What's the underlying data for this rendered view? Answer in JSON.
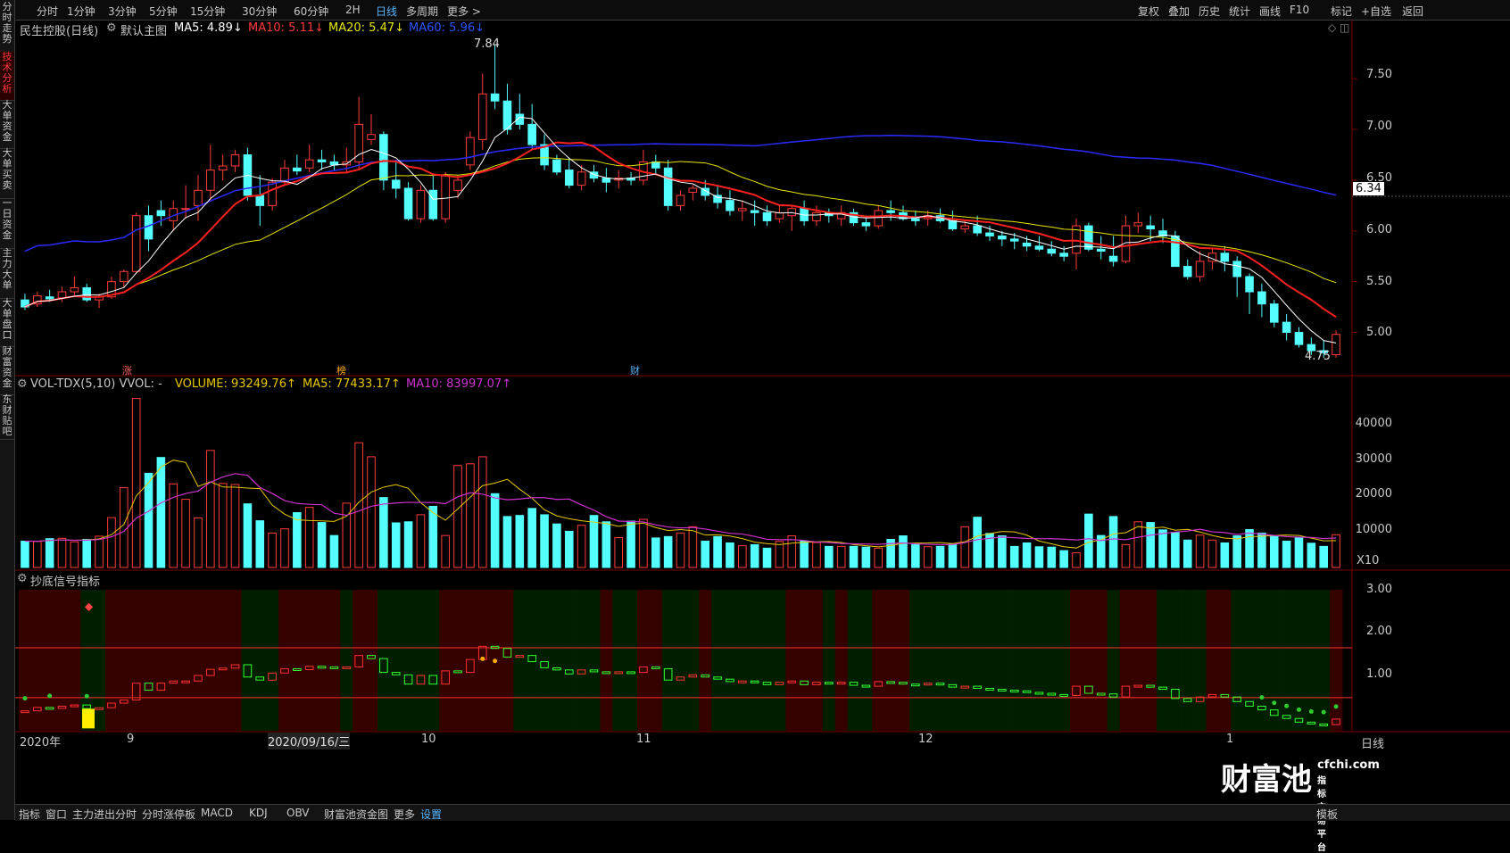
{
  "left_tabs": [
    "分时走势",
    "技术分析",
    "大单资金",
    "大单买卖",
    "一日资金",
    "主力大单",
    "大单盘口",
    "财富资金",
    "东财贴吧"
  ],
  "top_tabs": [
    "分时",
    "1分钟",
    "3分钟",
    "5分钟",
    "15分钟",
    "30分钟",
    "60分钟",
    "2H",
    "日线",
    "多周期",
    "更多 >"
  ],
  "active_top_tab": "日线",
  "top_right_tools": [
    "复权",
    "叠加",
    "历史",
    "统计",
    "画线",
    "F10",
    "标记",
    "+自选",
    "返回"
  ],
  "main_header": {
    "title": "民生控股(日线)",
    "chart_type": "默认主图",
    "ma5": "MA5: 4.89↓",
    "ma10": "MA10: 5.11↓",
    "ma20": "MA20: 5.47↓",
    "ma60": "MA60: 5.96↓"
  },
  "vol_header": {
    "name": "VOL-TDX(5,10) VVOL: -",
    "volume": "VOLUME: 93249.76↑",
    "ma5": "MA5: 77433.17↑",
    "ma10": "MA10: 83997.07↑"
  },
  "signal_header": "抄底信号指标",
  "price_axis": [
    "7.50",
    "7.00",
    "6.50",
    "6.00",
    "5.50",
    "5.00"
  ],
  "current_price": "6.34",
  "high_label": "7.84",
  "low_label": "4.75",
  "vol_axis": [
    "40000",
    "30000",
    "20000",
    "10000"
  ],
  "vol_unit": "X10",
  "signal_axis": [
    "3.00",
    "2.00",
    "1.00"
  ],
  "markers": [
    "涨",
    "榜",
    "财"
  ],
  "date_axis": [
    "2020年",
    "9",
    "2020/09/16/三",
    "10",
    "11",
    "12",
    "1"
  ],
  "period_label": "日线",
  "bottom_tabs": [
    "指标",
    "窗口",
    "主力进出分时",
    "分时涨停板",
    "MACD",
    "KDJ",
    "OBV",
    "财富池资金图",
    "更多",
    "设置"
  ],
  "active_bottom_tab": "设置",
  "bottom_right": "模板",
  "watermark": {
    "brand": "财富池",
    "site": "cfchi.com",
    "slogan": "指标交易平台"
  },
  "colors": {
    "up": "#ff3b3b",
    "down": "#54ffff",
    "ma5": "#ffffff",
    "ma10": "#ff2020",
    "ma20": "#e6e600",
    "ma60": "#2a2aff",
    "vma5": "#e6c800",
    "vma10": "#cc33cc"
  },
  "chart_data": {
    "type": "candlestick",
    "title": "民生控股(日线)",
    "ylim": [
      4.6,
      7.95
    ],
    "ohlc": [
      [
        5.32,
        5.38,
        5.22,
        5.25
      ],
      [
        5.28,
        5.4,
        5.25,
        5.36
      ],
      [
        5.35,
        5.42,
        5.3,
        5.33
      ],
      [
        5.34,
        5.45,
        5.3,
        5.4
      ],
      [
        5.4,
        5.55,
        5.36,
        5.44
      ],
      [
        5.44,
        5.48,
        5.3,
        5.32
      ],
      [
        5.32,
        5.38,
        5.24,
        5.35
      ],
      [
        5.35,
        5.55,
        5.33,
        5.5
      ],
      [
        5.5,
        5.62,
        5.44,
        5.6
      ],
      [
        5.6,
        6.18,
        5.58,
        6.15
      ],
      [
        6.15,
        6.25,
        5.8,
        5.92
      ],
      [
        6.2,
        6.3,
        6.05,
        6.15
      ],
      [
        6.1,
        6.3,
        6.0,
        6.22
      ],
      [
        6.22,
        6.45,
        6.12,
        6.22
      ],
      [
        6.25,
        6.55,
        6.1,
        6.4
      ],
      [
        6.4,
        6.85,
        6.3,
        6.6
      ],
      [
        6.6,
        6.75,
        6.5,
        6.64
      ],
      [
        6.64,
        6.8,
        6.58,
        6.75
      ],
      [
        6.75,
        6.82,
        6.3,
        6.35
      ],
      [
        6.35,
        6.55,
        6.05,
        6.25
      ],
      [
        6.25,
        6.52,
        6.2,
        6.48
      ],
      [
        6.48,
        6.7,
        6.45,
        6.62
      ],
      [
        6.62,
        6.75,
        6.55,
        6.59
      ],
      [
        6.62,
        6.85,
        6.58,
        6.7
      ],
      [
        6.7,
        6.8,
        6.6,
        6.68
      ],
      [
        6.68,
        6.75,
        6.6,
        6.65
      ],
      [
        6.65,
        6.82,
        6.58,
        6.68
      ],
      [
        6.68,
        7.32,
        6.6,
        7.05
      ],
      [
        6.9,
        7.15,
        6.85,
        6.95
      ],
      [
        6.95,
        6.98,
        6.4,
        6.5
      ],
      [
        6.5,
        6.7,
        6.32,
        6.42
      ],
      [
        6.42,
        6.48,
        6.1,
        6.12
      ],
      [
        6.12,
        6.45,
        6.08,
        6.4
      ],
      [
        6.4,
        6.55,
        6.1,
        6.12
      ],
      [
        6.12,
        6.58,
        6.08,
        6.55
      ],
      [
        6.4,
        6.55,
        6.32,
        6.5
      ],
      [
        6.65,
        6.98,
        6.6,
        6.92
      ],
      [
        6.9,
        7.55,
        6.8,
        7.35
      ],
      [
        7.35,
        7.84,
        7.2,
        7.28
      ],
      [
        7.28,
        7.45,
        6.95,
        7.0
      ],
      [
        7.15,
        7.35,
        7.0,
        7.05
      ],
      [
        7.05,
        7.25,
        6.8,
        6.85
      ],
      [
        6.85,
        6.95,
        6.6,
        6.65
      ],
      [
        6.7,
        6.75,
        6.55,
        6.58
      ],
      [
        6.6,
        6.72,
        6.42,
        6.45
      ],
      [
        6.45,
        6.65,
        6.4,
        6.58
      ],
      [
        6.58,
        6.65,
        6.48,
        6.52
      ],
      [
        6.52,
        6.62,
        6.38,
        6.48
      ],
      [
        6.5,
        6.6,
        6.42,
        6.52
      ],
      [
        6.52,
        6.58,
        6.45,
        6.5
      ],
      [
        6.5,
        6.8,
        6.45,
        6.68
      ],
      [
        6.68,
        6.75,
        6.55,
        6.62
      ],
      [
        6.62,
        6.7,
        6.2,
        6.25
      ],
      [
        6.25,
        6.4,
        6.2,
        6.35
      ],
      [
        6.38,
        6.45,
        6.3,
        6.42
      ],
      [
        6.42,
        6.5,
        6.3,
        6.35
      ],
      [
        6.35,
        6.45,
        6.22,
        6.28
      ],
      [
        6.3,
        6.4,
        6.15,
        6.2
      ],
      [
        6.2,
        6.3,
        6.1,
        6.22
      ],
      [
        6.2,
        6.3,
        6.05,
        6.18
      ],
      [
        6.18,
        6.25,
        6.05,
        6.1
      ],
      [
        6.12,
        6.25,
        6.08,
        6.18
      ],
      [
        6.15,
        6.25,
        6.0,
        6.22
      ],
      [
        6.22,
        6.3,
        6.05,
        6.1
      ],
      [
        6.1,
        6.25,
        6.05,
        6.18
      ],
      [
        6.18,
        6.22,
        6.08,
        6.15
      ],
      [
        6.12,
        6.25,
        6.05,
        6.18
      ],
      [
        6.18,
        6.22,
        6.05,
        6.08
      ],
      [
        6.08,
        6.15,
        6.0,
        6.05
      ],
      [
        6.05,
        6.25,
        6.02,
        6.2
      ],
      [
        6.2,
        6.3,
        6.1,
        6.18
      ],
      [
        6.18,
        6.25,
        6.1,
        6.12
      ],
      [
        6.12,
        6.2,
        6.05,
        6.1
      ],
      [
        6.12,
        6.2,
        6.05,
        6.15
      ],
      [
        6.15,
        6.22,
        6.08,
        6.1
      ],
      [
        6.1,
        6.2,
        6.0,
        6.02
      ],
      [
        6.02,
        6.1,
        5.98,
        6.05
      ],
      [
        6.05,
        6.15,
        5.95,
        5.98
      ],
      [
        5.98,
        6.05,
        5.9,
        5.95
      ],
      [
        5.95,
        6.0,
        5.85,
        5.92
      ],
      [
        5.92,
        5.98,
        5.82,
        5.9
      ],
      [
        5.88,
        5.95,
        5.8,
        5.85
      ],
      [
        5.85,
        5.95,
        5.8,
        5.82
      ],
      [
        5.82,
        5.9,
        5.75,
        5.78
      ],
      [
        5.78,
        5.85,
        5.7,
        5.75
      ],
      [
        5.78,
        6.12,
        5.62,
        6.05
      ],
      [
        6.05,
        6.08,
        5.8,
        5.82
      ],
      [
        5.82,
        5.95,
        5.72,
        5.8
      ],
      [
        5.75,
        5.95,
        5.65,
        5.7
      ],
      [
        5.7,
        6.15,
        5.68,
        6.05
      ],
      [
        6.05,
        6.18,
        5.98,
        6.08
      ],
      [
        6.05,
        6.15,
        5.9,
        6.02
      ],
      [
        6.0,
        6.12,
        5.88,
        5.95
      ],
      [
        5.95,
        6.0,
        5.65,
        5.65
      ],
      [
        5.65,
        5.72,
        5.52,
        5.55
      ],
      [
        5.55,
        5.8,
        5.5,
        5.7
      ],
      [
        5.7,
        5.82,
        5.62,
        5.78
      ],
      [
        5.78,
        5.85,
        5.6,
        5.7
      ],
      [
        5.7,
        5.75,
        5.35,
        5.55
      ],
      [
        5.55,
        5.58,
        5.18,
        5.4
      ],
      [
        5.4,
        5.48,
        5.15,
        5.28
      ],
      [
        5.28,
        5.32,
        5.05,
        5.1
      ],
      [
        5.1,
        5.18,
        4.92,
        5.0
      ],
      [
        5.0,
        5.05,
        4.85,
        4.88
      ],
      [
        4.88,
        4.95,
        4.78,
        4.82
      ],
      [
        4.82,
        4.92,
        4.75,
        4.8
      ],
      [
        4.78,
        5.02,
        4.75,
        4.98
      ]
    ],
    "volume": [
      7500,
      7400,
      8200,
      8300,
      7300,
      8000,
      8900,
      14200,
      22700,
      48100,
      26800,
      31300,
      23800,
      19400,
      14100,
      33300,
      23900,
      23600,
      18100,
      13300,
      9800,
      11000,
      15600,
      17100,
      12800,
      9100,
      18300,
      35500,
      31500,
      19900,
      12700,
      13000,
      15000,
      17400,
      9100,
      29000,
      29500,
      31500,
      21000,
      14500,
      14800,
      16800,
      15000,
      12400,
      10300,
      12000,
      14800,
      13000,
      8500,
      13200,
      13700,
      8400,
      8800,
      9800,
      11600,
      7500,
      8800,
      7000,
      6200,
      6500,
      5500,
      7400,
      9000,
      7500,
      7100,
      6000,
      6000,
      6000,
      5800,
      5500,
      8000,
      9000,
      6500,
      5900,
      6000,
      6600,
      11600,
      14300,
      9700,
      9000,
      6000,
      7000,
      5900,
      5800,
      4800,
      4200,
      15200,
      9100,
      14500,
      6500,
      13000,
      12800,
      10700,
      10000,
      7800,
      9200,
      7800,
      7000,
      9000,
      10800,
      9800,
      9000,
      7500,
      8500,
      6900,
      6000,
      9325
    ]
  }
}
